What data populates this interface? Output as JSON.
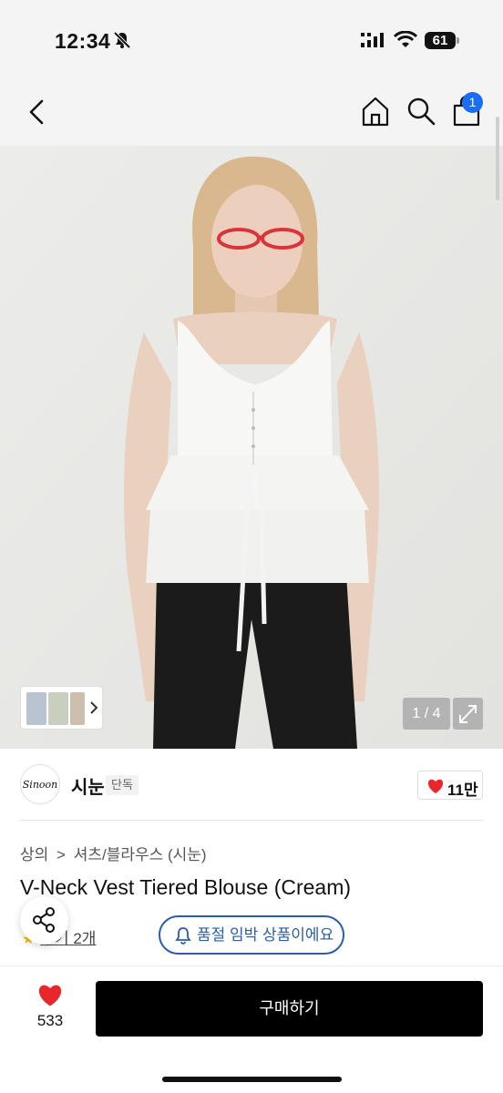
{
  "status_bar": {
    "time": "12:34",
    "battery": "61"
  },
  "nav": {
    "cart_count": "1"
  },
  "gallery": {
    "page_indicator": "1 / 4"
  },
  "shop": {
    "name": "시눈",
    "logo_text": "Sinoon",
    "badge": "단독",
    "likes": "11만"
  },
  "product": {
    "breadcrumb": [
      "상의",
      ">",
      "셔츠/블라우스 (시눈)"
    ],
    "title": "V-Neck Vest Tiered Blouse (Cream)",
    "reviews": "후기 2개",
    "stock_alert": "품절 임박 상품이에요"
  },
  "bottom_bar": {
    "wish_count": "533",
    "buy_label": "구매하기"
  },
  "colors": {
    "accent_blue": "#1a6ef5",
    "alert_blue": "#2a5ea8",
    "heart_red": "#e8262b",
    "buy_black": "#000000"
  }
}
